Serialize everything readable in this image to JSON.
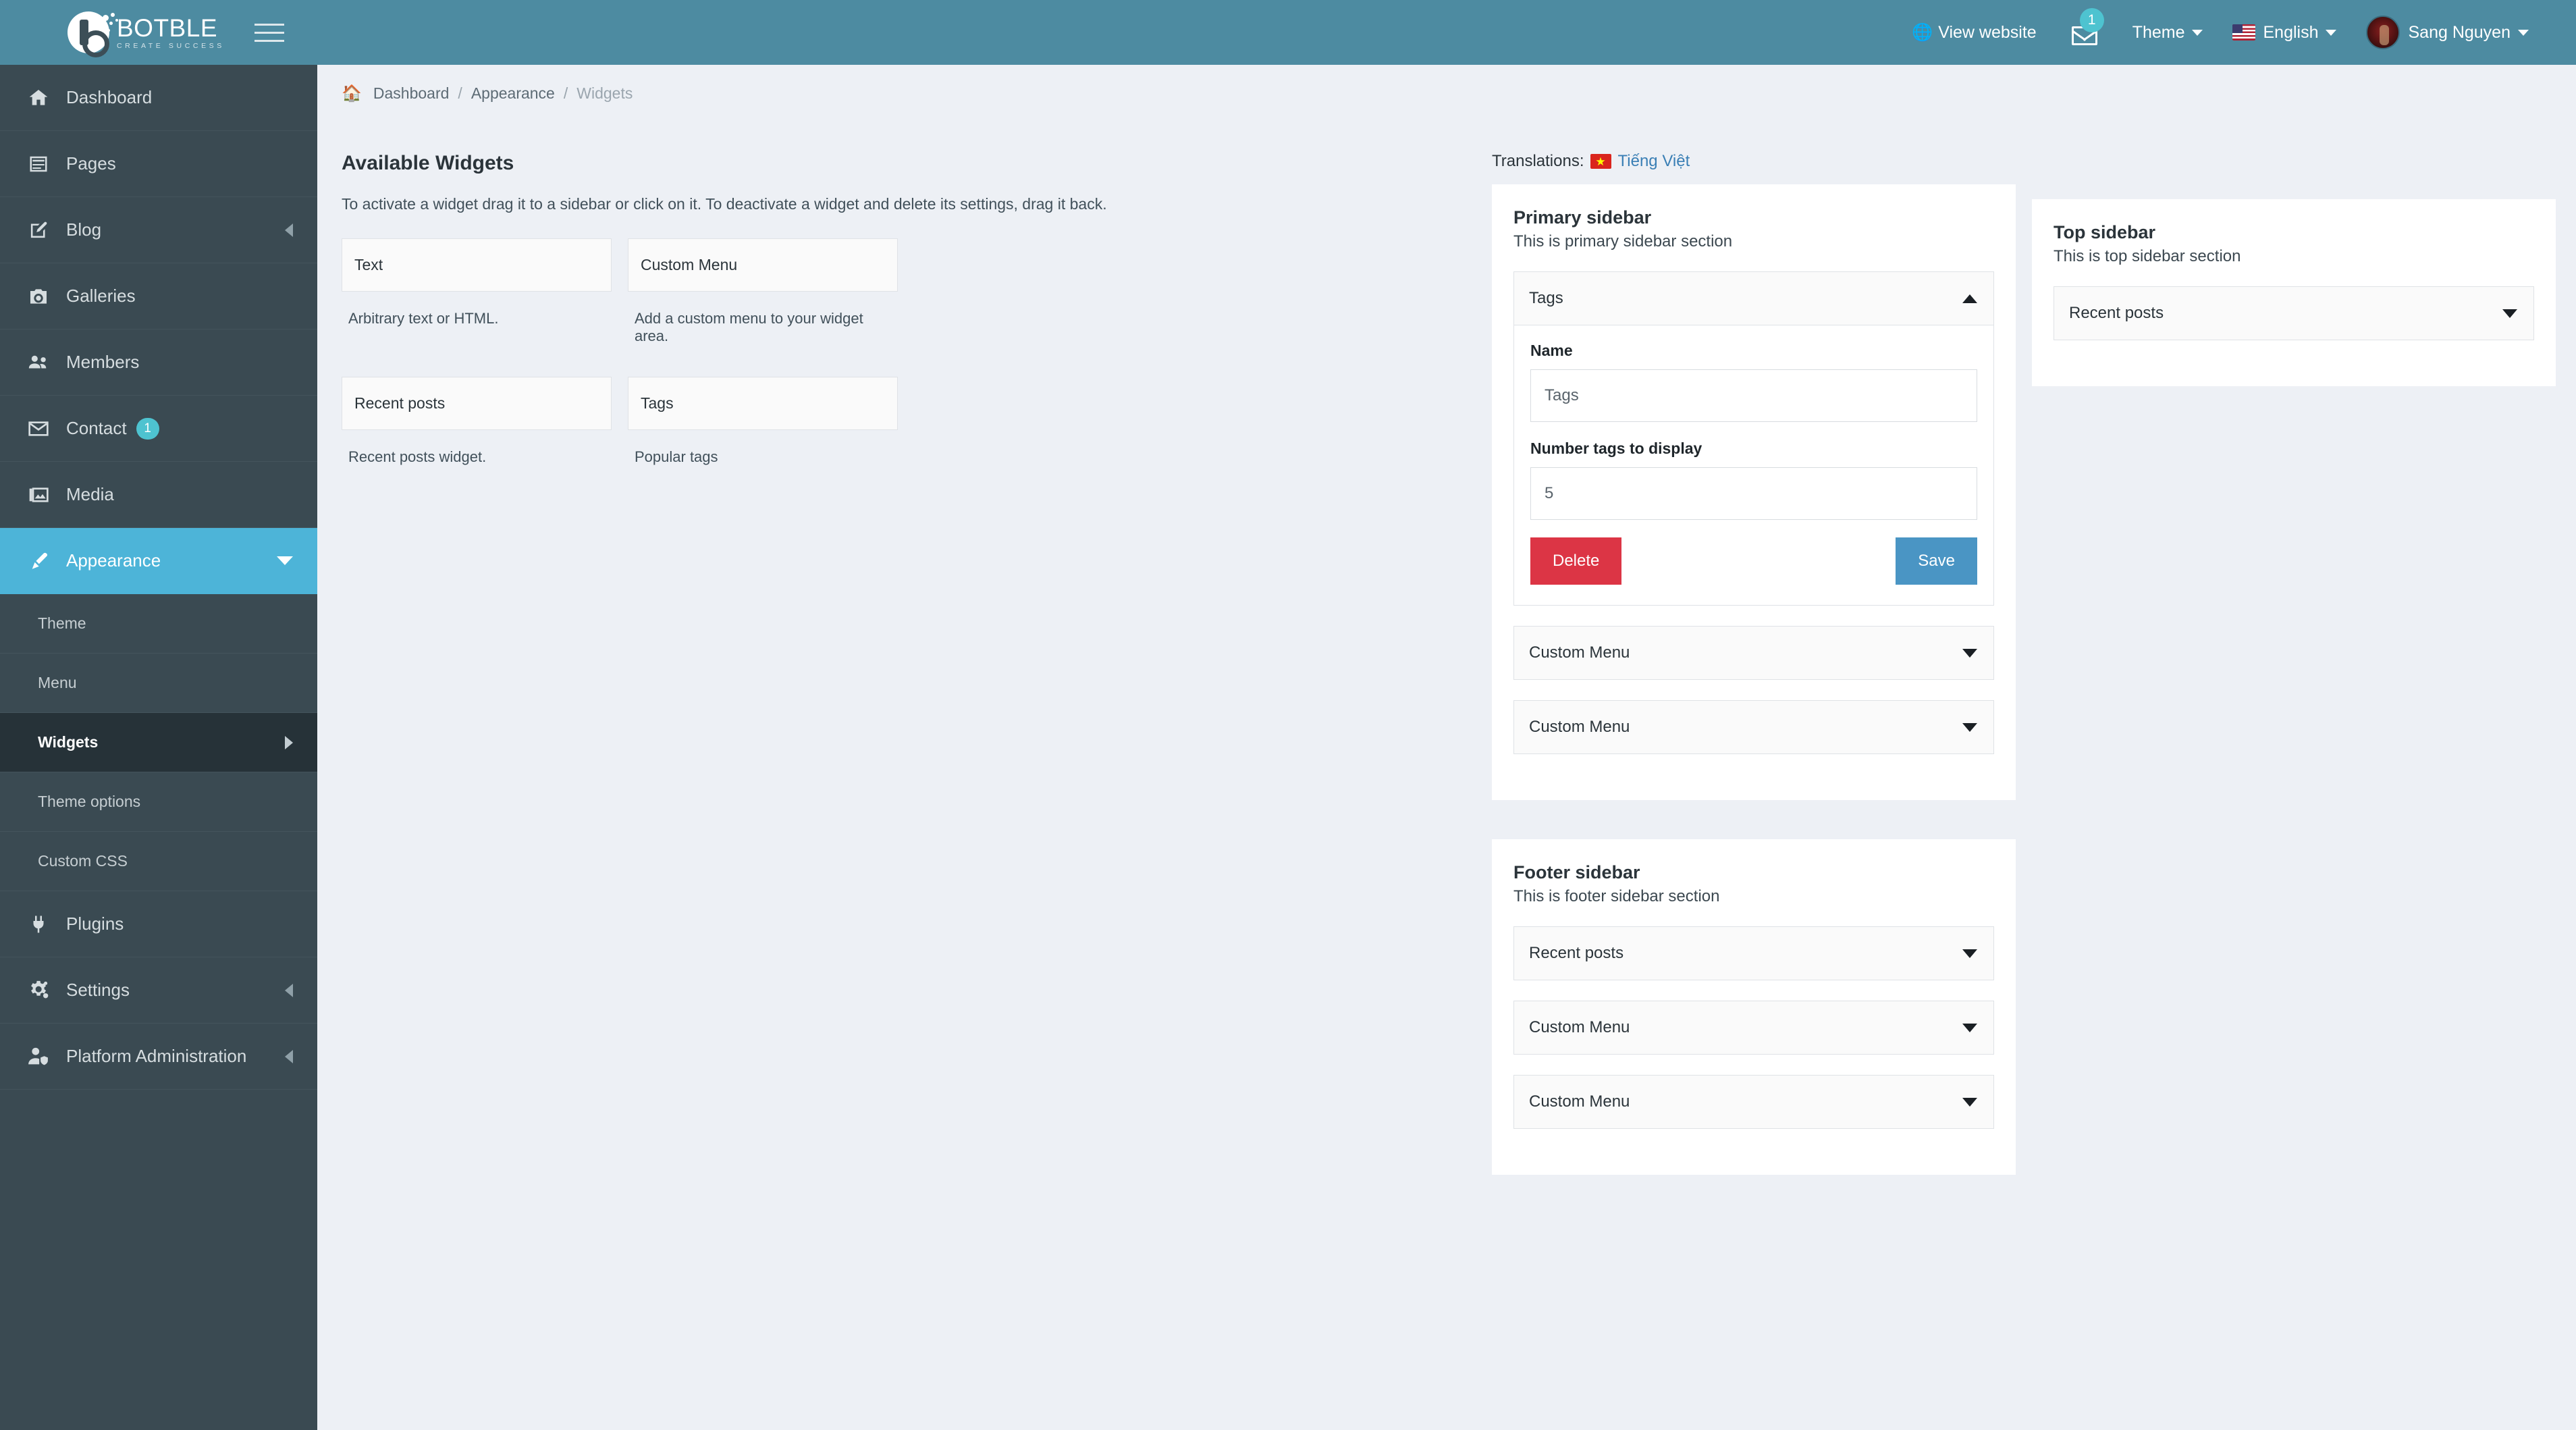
{
  "header": {
    "brand_main": "BOTBLE",
    "brand_sub": "CREATE SUCCESS",
    "view_website": "View website",
    "mail_badge": "1",
    "theme": "Theme",
    "language": "English",
    "user": "Sang Nguyen"
  },
  "sidebar": {
    "items": [
      {
        "label": "Dashboard",
        "icon": "home-icon",
        "badge": null,
        "chevron": null
      },
      {
        "label": "Pages",
        "icon": "pages-icon",
        "badge": null,
        "chevron": null
      },
      {
        "label": "Blog",
        "icon": "blog-pencil-icon",
        "badge": null,
        "chevron": "left"
      },
      {
        "label": "Galleries",
        "icon": "camera-icon",
        "badge": null,
        "chevron": null
      },
      {
        "label": "Members",
        "icon": "users-icon",
        "badge": null,
        "chevron": null
      },
      {
        "label": "Contact",
        "icon": "envelope-icon",
        "badge": "1",
        "chevron": null
      },
      {
        "label": "Media",
        "icon": "media-images-icon",
        "badge": null,
        "chevron": null
      },
      {
        "label": "Appearance",
        "icon": "paint-brush-icon",
        "badge": null,
        "chevron": "down",
        "active": true
      }
    ],
    "appearance_children": [
      {
        "label": "Theme",
        "active": false
      },
      {
        "label": "Menu",
        "active": false
      },
      {
        "label": "Widgets",
        "active": true,
        "chevron": "right"
      },
      {
        "label": "Theme options",
        "active": false
      },
      {
        "label": "Custom CSS",
        "active": false
      }
    ],
    "items_after": [
      {
        "label": "Plugins",
        "icon": "plug-icon",
        "chevron": null
      },
      {
        "label": "Settings",
        "icon": "gears-icon",
        "chevron": "left"
      },
      {
        "label": "Platform Administration",
        "icon": "user-shield-icon",
        "chevron": "left"
      }
    ]
  },
  "breadcrumb": {
    "home": "Dashboard",
    "parent": "Appearance",
    "current": "Widgets"
  },
  "available": {
    "title": "Available Widgets",
    "description": "To activate a widget drag it to a sidebar or click on it. To deactivate a widget and delete its settings, drag it back.",
    "widgets": [
      {
        "name": "Text",
        "description": "Arbitrary text or HTML."
      },
      {
        "name": "Custom Menu",
        "description": "Add a custom menu to your widget area."
      },
      {
        "name": "Recent posts",
        "description": "Recent posts widget."
      },
      {
        "name": "Tags",
        "description": "Popular tags"
      }
    ]
  },
  "translations": {
    "label": "Translations:",
    "language": "Tiếng Việt"
  },
  "sidebars": [
    {
      "key": "primary",
      "title": "Primary sidebar",
      "subtitle": "This is primary sidebar section",
      "widgets": [
        {
          "name": "Tags",
          "expanded": true,
          "fields": [
            {
              "label": "Name",
              "value": "Tags"
            },
            {
              "label": "Number tags to display",
              "value": "5"
            }
          ],
          "delete_label": "Delete",
          "save_label": "Save"
        },
        {
          "name": "Custom Menu",
          "expanded": false
        },
        {
          "name": "Custom Menu",
          "expanded": false
        }
      ]
    },
    {
      "key": "footer",
      "title": "Footer sidebar",
      "subtitle": "This is footer sidebar section",
      "widgets": [
        {
          "name": "Recent posts",
          "expanded": false
        },
        {
          "name": "Custom Menu",
          "expanded": false
        },
        {
          "name": "Custom Menu",
          "expanded": false
        }
      ]
    },
    {
      "key": "top",
      "title": "Top sidebar",
      "subtitle": "This is top sidebar section",
      "widgets": [
        {
          "name": "Recent posts",
          "expanded": false
        }
      ]
    }
  ],
  "colors": {
    "header_bg": "#4d8ba1",
    "sidebar_bg": "#3a4a52",
    "sidebar_active": "#4db4d8",
    "sidebar_sub_active": "#263238",
    "content_bg": "#edf0f5",
    "badge": "#4ec3d0",
    "delete": "#dc3545",
    "save": "#4a95c4",
    "link": "#3a7fb5"
  }
}
